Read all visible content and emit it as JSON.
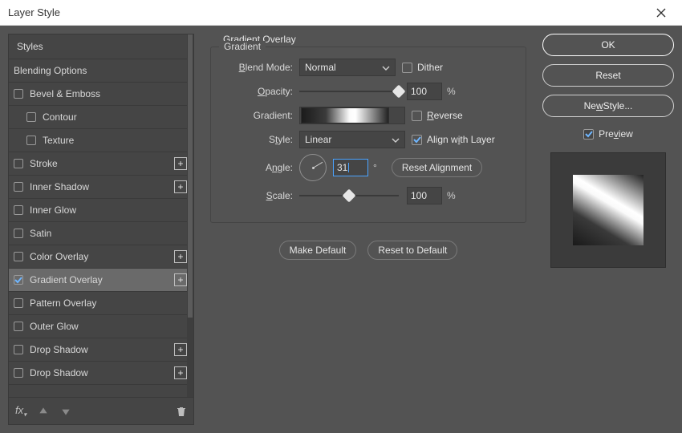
{
  "window": {
    "title": "Layer Style"
  },
  "sidebar": {
    "header": "Styles",
    "items": [
      {
        "label": "Blending Options",
        "hasCheckbox": false,
        "checked": false,
        "indent": 0,
        "plus": false
      },
      {
        "label": "Bevel & Emboss",
        "hasCheckbox": true,
        "checked": false,
        "indent": 0,
        "plus": false
      },
      {
        "label": "Contour",
        "hasCheckbox": true,
        "checked": false,
        "indent": 1,
        "plus": false
      },
      {
        "label": "Texture",
        "hasCheckbox": true,
        "checked": false,
        "indent": 1,
        "plus": false
      },
      {
        "label": "Stroke",
        "hasCheckbox": true,
        "checked": false,
        "indent": 0,
        "plus": true
      },
      {
        "label": "Inner Shadow",
        "hasCheckbox": true,
        "checked": false,
        "indent": 0,
        "plus": true
      },
      {
        "label": "Inner Glow",
        "hasCheckbox": true,
        "checked": false,
        "indent": 0,
        "plus": false
      },
      {
        "label": "Satin",
        "hasCheckbox": true,
        "checked": false,
        "indent": 0,
        "plus": false
      },
      {
        "label": "Color Overlay",
        "hasCheckbox": true,
        "checked": false,
        "indent": 0,
        "plus": true
      },
      {
        "label": "Gradient Overlay",
        "hasCheckbox": true,
        "checked": true,
        "indent": 0,
        "plus": true,
        "selected": true
      },
      {
        "label": "Pattern Overlay",
        "hasCheckbox": true,
        "checked": false,
        "indent": 0,
        "plus": false
      },
      {
        "label": "Outer Glow",
        "hasCheckbox": true,
        "checked": false,
        "indent": 0,
        "plus": false
      },
      {
        "label": "Drop Shadow",
        "hasCheckbox": true,
        "checked": false,
        "indent": 0,
        "plus": true
      },
      {
        "label": "Drop Shadow",
        "hasCheckbox": true,
        "checked": false,
        "indent": 0,
        "plus": true
      }
    ]
  },
  "panel": {
    "title": "Gradient Overlay",
    "fieldset": "Gradient",
    "blendMode": {
      "label": "Blend Mode:",
      "value": "Normal"
    },
    "dither": {
      "label": "Dither",
      "checked": false
    },
    "opacity": {
      "label": "Opacity:",
      "value": "100",
      "unit": "%",
      "sliderPct": 100
    },
    "gradient": {
      "label": "Gradient:"
    },
    "reverse": {
      "label": "Reverse",
      "checked": false
    },
    "style": {
      "label": "Style:",
      "value": "Linear"
    },
    "align": {
      "label": "Align with Layer",
      "checked": true
    },
    "angle": {
      "label": "Angle:",
      "value": "31",
      "unit": "°"
    },
    "resetAlign": "Reset Alignment",
    "scale": {
      "label": "Scale:",
      "value": "100",
      "unit": "%",
      "sliderPct": 50
    },
    "makeDefault": "Make Default",
    "resetDefault": "Reset to Default"
  },
  "actions": {
    "ok": "OK",
    "reset": "Reset",
    "newStyle": "New Style...",
    "preview": {
      "label": "Preview",
      "checked": true
    }
  }
}
